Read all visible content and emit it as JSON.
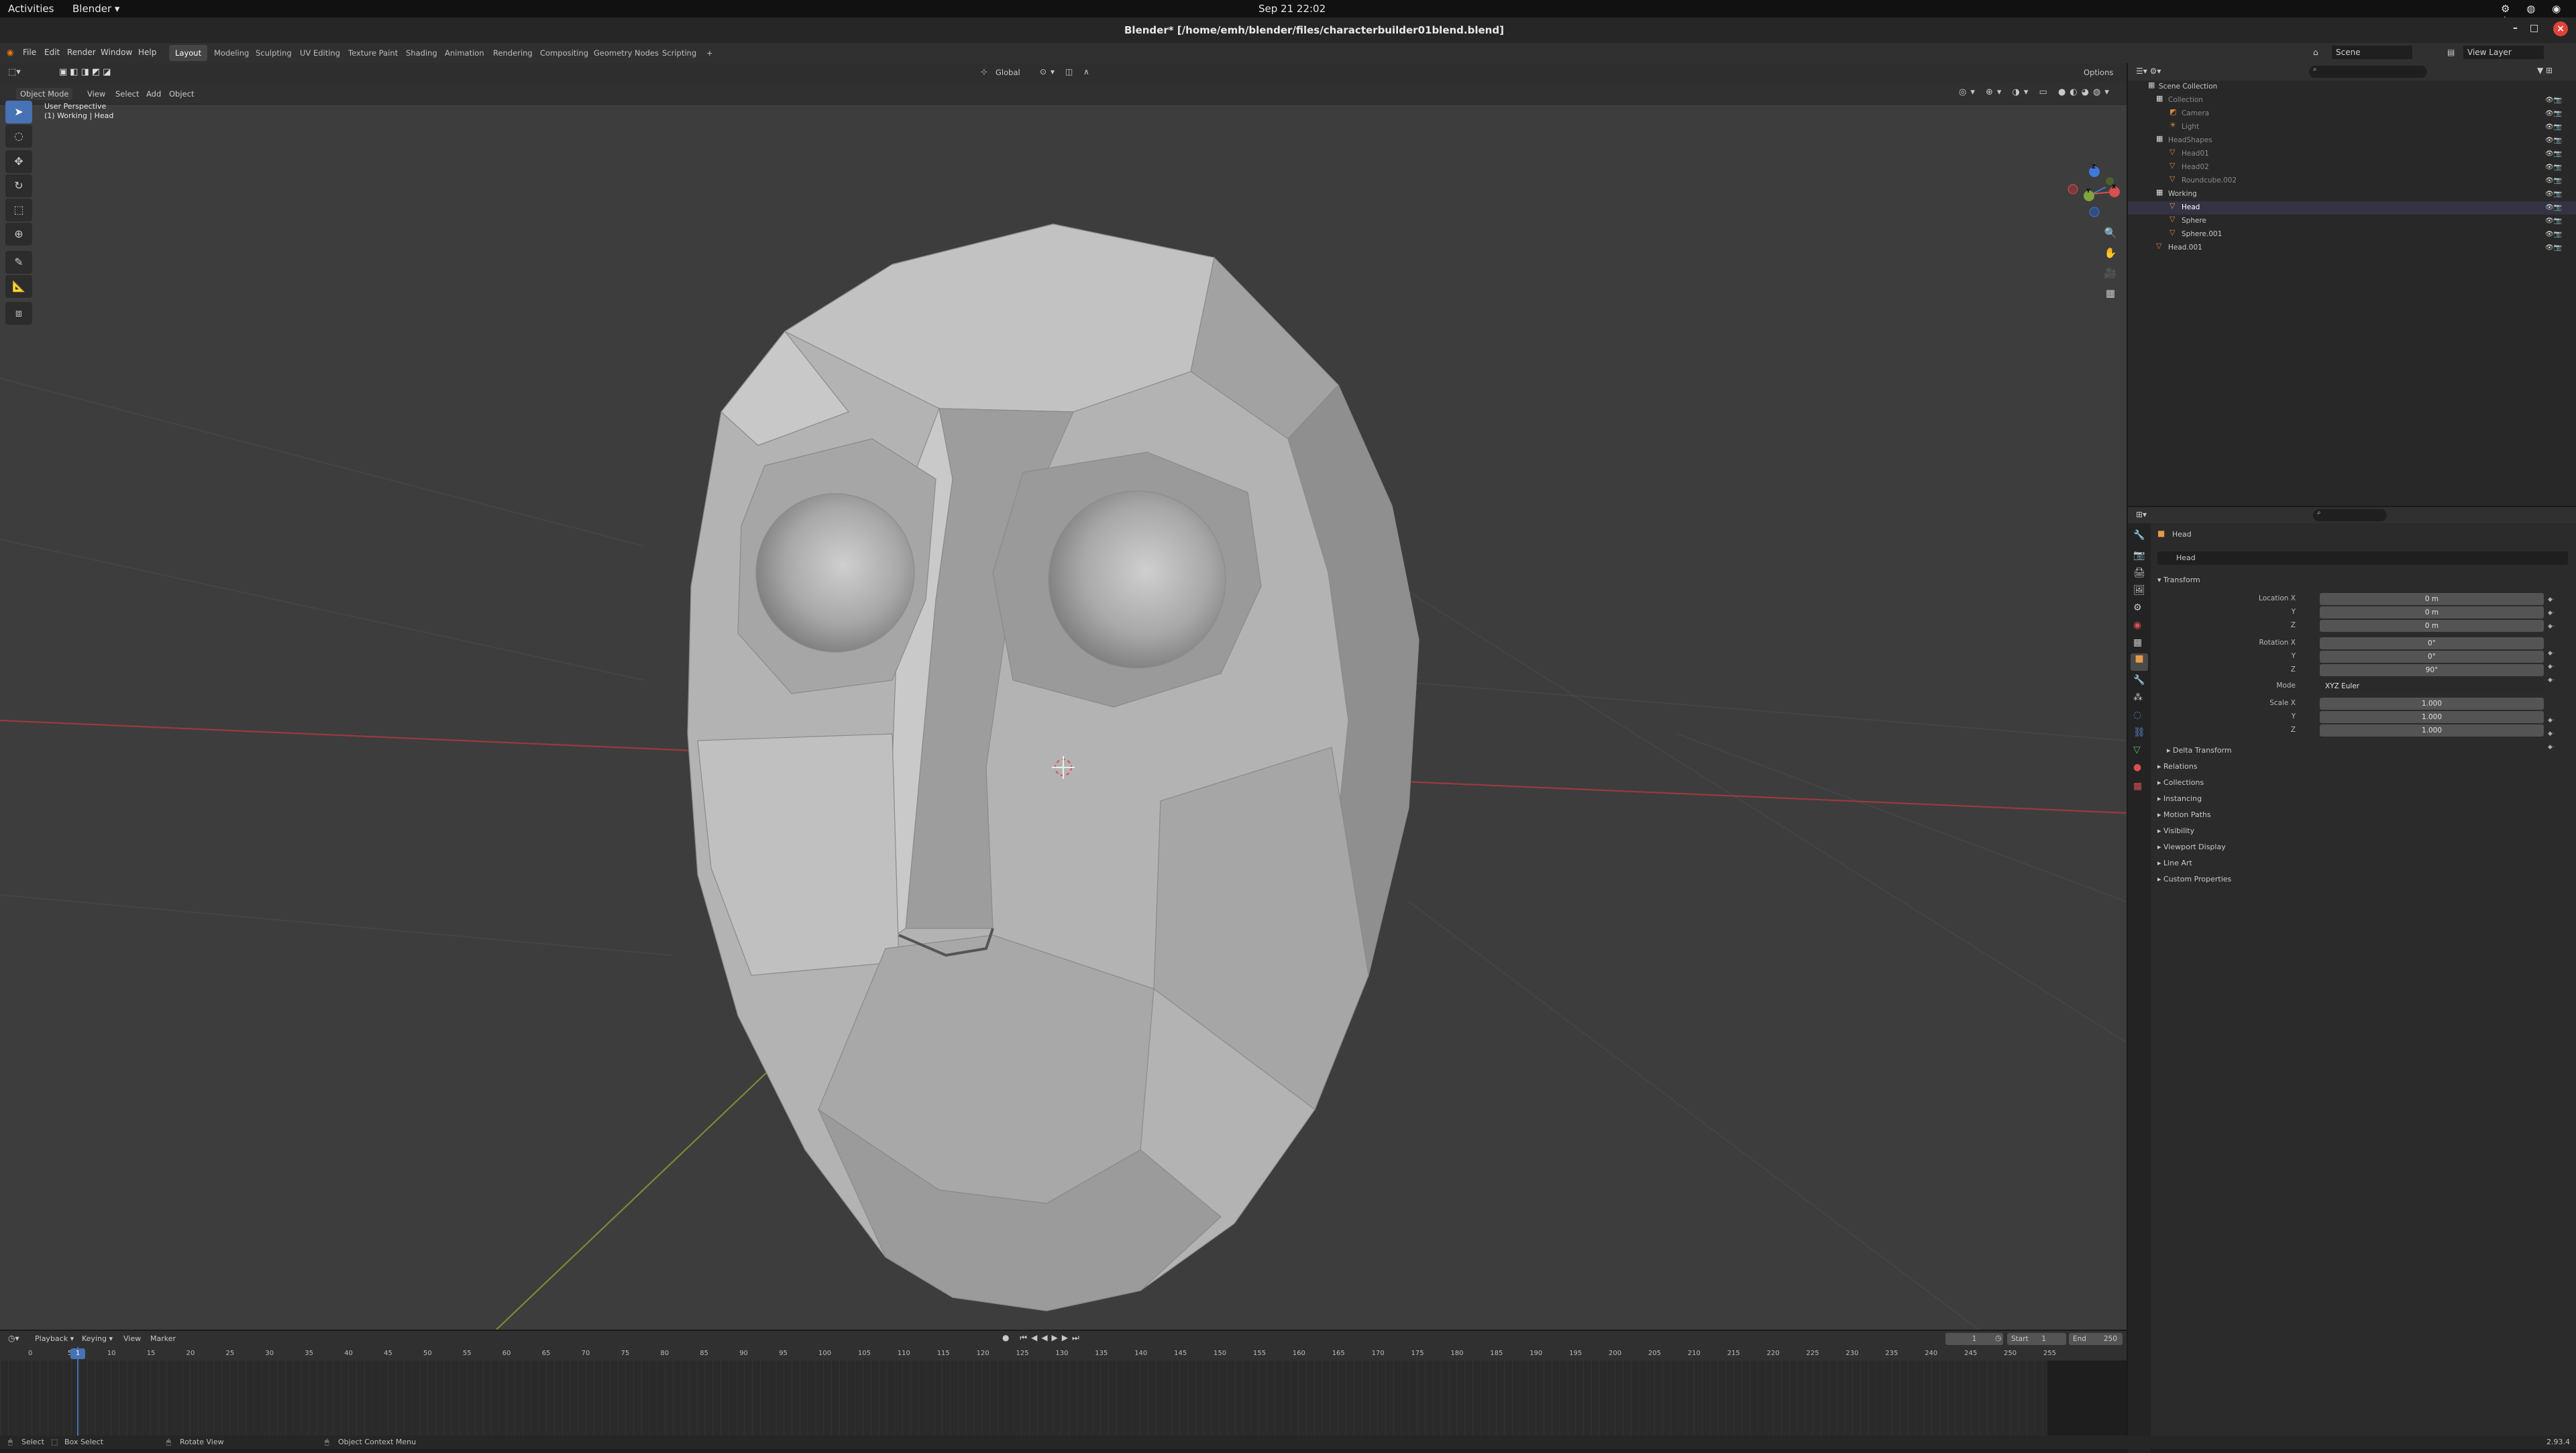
{
  "system_bar": {
    "activities": "Activities",
    "app": "Blender",
    "clock": "Sep 21  22:02"
  },
  "window": {
    "title": "Blender* [/home/emh/blender/files/characterbuilder01blend.blend]"
  },
  "menu": {
    "items": [
      "File",
      "Edit",
      "Render",
      "Window",
      "Help"
    ]
  },
  "workspaces": [
    "Layout",
    "Modeling",
    "Sculpting",
    "UV Editing",
    "Texture Paint",
    "Shading",
    "Animation",
    "Rendering",
    "Compositing",
    "Geometry Nodes",
    "Scripting"
  ],
  "scene_selector": {
    "scene": "Scene",
    "view_layer": "View Layer"
  },
  "viewport": {
    "mode": "Object Mode",
    "menus": [
      "View",
      "Select",
      "Add",
      "Object"
    ],
    "transform_orientation": "Global",
    "options_label": "Options",
    "overlay_line1": "User Perspective",
    "overlay_line2": "(1) Working | Head",
    "gizmo_axes": [
      "X",
      "Y",
      "Z"
    ]
  },
  "outliner": {
    "header": "Scene Collection",
    "rows": [
      {
        "label": "Collection",
        "dim": true
      },
      {
        "label": "Camera",
        "dim": true
      },
      {
        "label": "Light",
        "dim": true
      },
      {
        "label": "HeadShapes",
        "dim": true
      },
      {
        "label": "Head01",
        "dim": true
      },
      {
        "label": "Head02",
        "dim": true
      },
      {
        "label": "Roundcube.002",
        "dim": true
      },
      {
        "label": "Working",
        "dim": false
      },
      {
        "label": "Head",
        "dim": false
      },
      {
        "label": "Sphere",
        "dim": false
      },
      {
        "label": "Sphere.001",
        "dim": false
      },
      {
        "label": "Head.001",
        "dim": false
      }
    ]
  },
  "properties": {
    "object_name": "Head",
    "name_field": "Head",
    "transform_title": "Transform",
    "location_label": "Location X",
    "rotation_label": "Rotation X",
    "scale_label": "Scale X",
    "axis_y": "Y",
    "axis_z": "Z",
    "location": [
      "0 m",
      "0 m",
      "0 m"
    ],
    "rotation": [
      "0°",
      "0°",
      "90°"
    ],
    "mode_label": "Mode",
    "mode_value": "XYZ Euler",
    "scale": [
      "1.000",
      "1.000",
      "1.000"
    ],
    "delta_transform": "Delta Transform",
    "sections": [
      "Relations",
      "Collections",
      "Instancing",
      "Motion Paths",
      "Visibility",
      "Viewport Display",
      "Line Art",
      "Custom Properties"
    ]
  },
  "timeline": {
    "menus": [
      "Playback",
      "Keying",
      "View",
      "Marker"
    ],
    "current_frame": "1",
    "start_label": "Start",
    "start_value": "1",
    "end_label": "End",
    "end_value": "250",
    "ruler": [
      "0",
      "5",
      "10",
      "15",
      "20",
      "25",
      "30",
      "35",
      "40",
      "45",
      "50",
      "55",
      "60",
      "65",
      "70",
      "75",
      "80",
      "85",
      "90",
      "95",
      "100",
      "105",
      "110",
      "115",
      "120",
      "125",
      "130",
      "135",
      "140",
      "145",
      "150",
      "155",
      "160",
      "165",
      "170",
      "175",
      "180",
      "185",
      "190",
      "195",
      "200",
      "205",
      "210",
      "215",
      "220",
      "225",
      "230",
      "235",
      "240",
      "245",
      "250",
      "255"
    ]
  },
  "status_bar": {
    "select": "Select",
    "box_select": "Box Select",
    "rotate_view": "Rotate View",
    "context_menu": "Object Context Menu",
    "version": "2.93.4"
  }
}
